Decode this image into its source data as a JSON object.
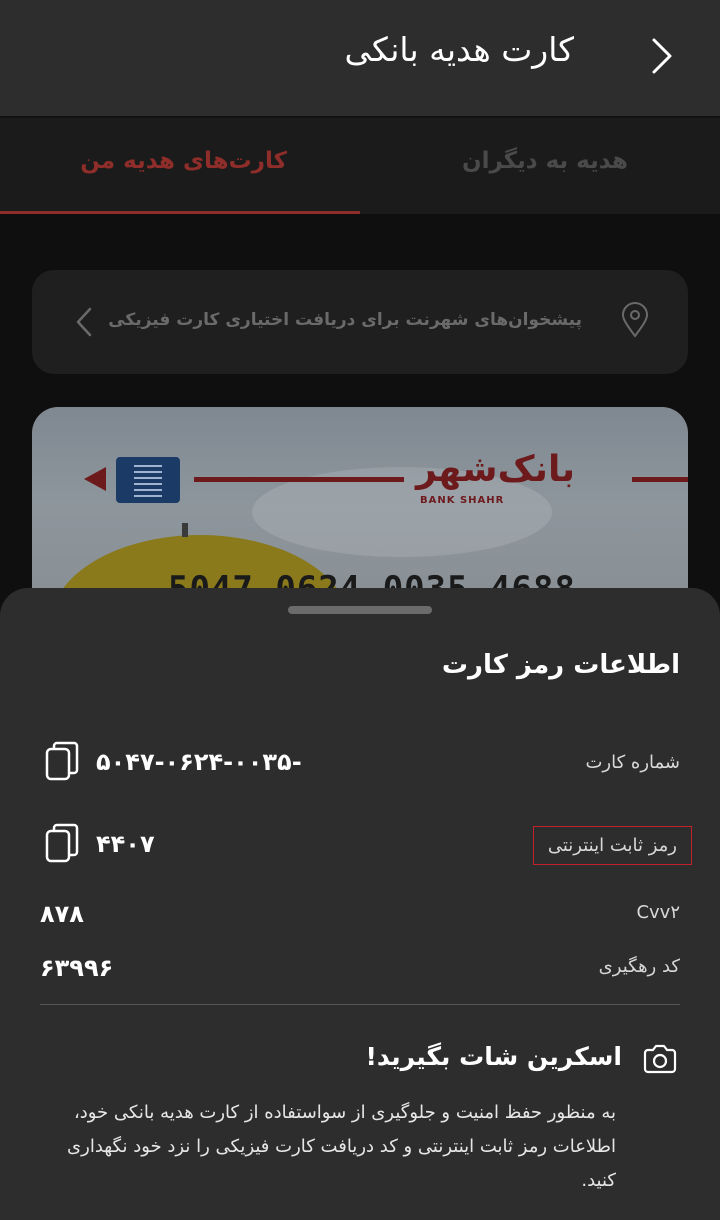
{
  "header": {
    "title": "کارت هدیه بانکی"
  },
  "tabs": [
    {
      "label": "کارت‌های هدیه من"
    },
    {
      "label": "هدیه به دیگران"
    }
  ],
  "branch_banner": {
    "label": "پیشخوان‌های شهرنت برای دریافت اختیاری کارت فیزیکی"
  },
  "card": {
    "bank_name_fa": "بانک‌شهر",
    "bank_name_en": "BANK SHAHR",
    "number": "5047 0624 0035 4688"
  },
  "sheet": {
    "title": "اطلاعات رمز کارت",
    "rows": [
      {
        "label": "شماره کارت",
        "value": "۵۰۴۷-۰۶۲۴-۰۰۳۵-"
      },
      {
        "label": "رمز ثابت اینترنتی",
        "value": "۴۴۰۷"
      },
      {
        "label": "Cvv۲",
        "value": "۸۷۸"
      },
      {
        "label": "کد رهگیری",
        "value": "۶۳۹۹۶"
      }
    ],
    "screenshot": {
      "title": "اسکرین شات بگیرید!",
      "text": "به منظور حفظ امنیت و جلوگیری از سواستفاده از کارت هدیه بانکی خود، اطلاعات رمز ثابت اینترنتی و کد دریافت کارت فیزیکی را نزد خود نگهداری کنید."
    }
  },
  "colors": {
    "accent": "#8e2d29",
    "highlight_border": "#c0212b"
  }
}
